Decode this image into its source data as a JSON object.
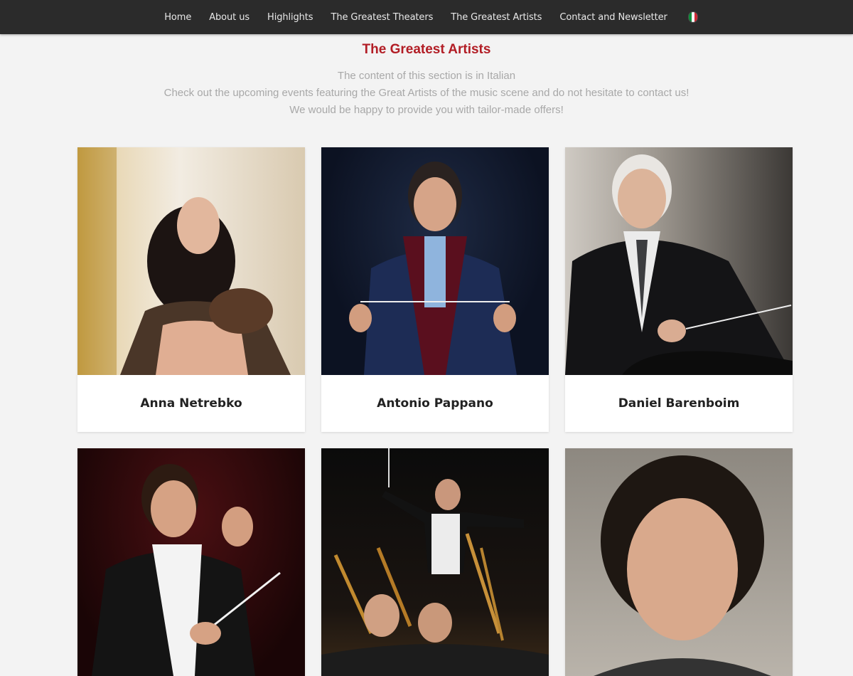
{
  "nav": {
    "items": [
      "Home",
      "About us",
      "Highlights",
      "The Greatest Theaters",
      "The Greatest Artists",
      "Contact and Newsletter"
    ],
    "language_flag": "italian-flag-icon"
  },
  "page": {
    "title": "The Greatest Artists",
    "intro_lines": [
      "The content of this section is in Italian",
      "Check out the upcoming events featuring the Great Artists of the music scene and do not hesitate to contact us!",
      "We would be happy to provide you with tailor-made offers!"
    ]
  },
  "artists": [
    {
      "name": "Anna Netrebko"
    },
    {
      "name": "Antonio Pappano"
    },
    {
      "name": "Daniel Barenboim"
    },
    {
      "name": ""
    },
    {
      "name": ""
    },
    {
      "name": ""
    }
  ],
  "colors": {
    "nav_bg": "#2b2b2b",
    "title_red": "#b21d25",
    "page_bg": "#f3f3f3"
  }
}
